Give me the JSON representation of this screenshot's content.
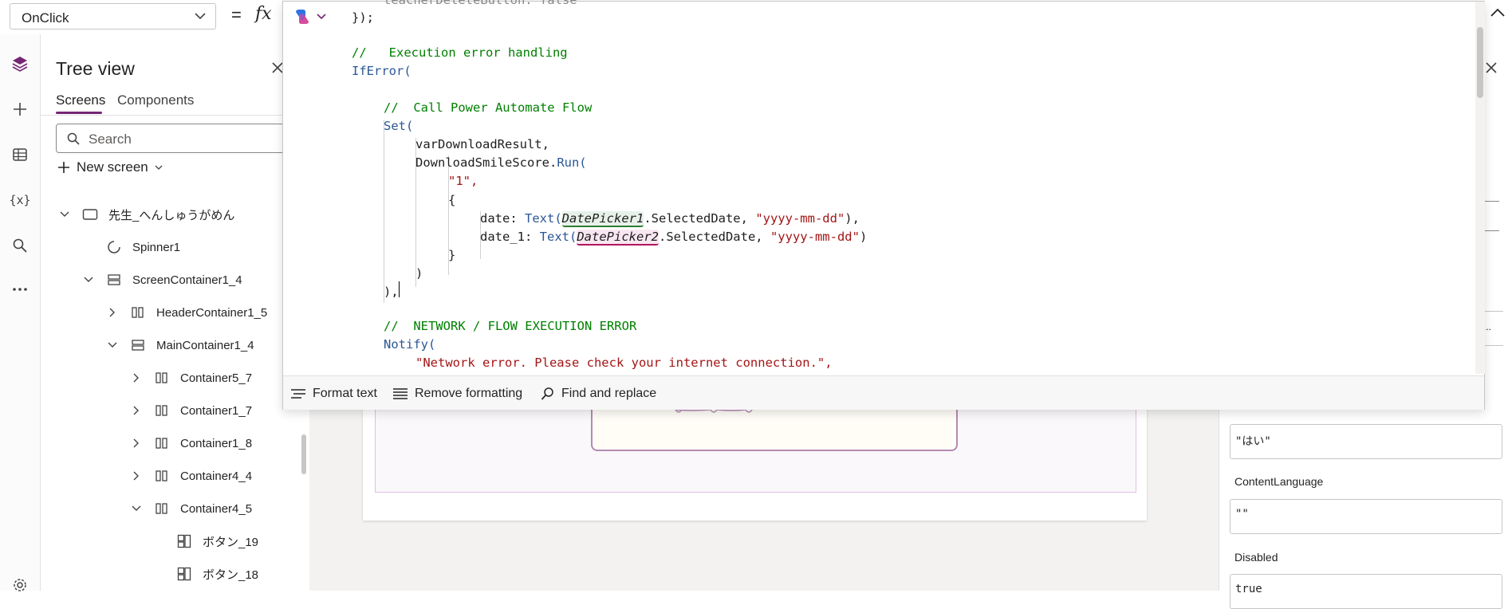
{
  "formula_bar": {
    "property": "OnClick",
    "equals": "=",
    "fx": "fx"
  },
  "tree_view": {
    "title": "Tree view",
    "tabs": {
      "screens": "Screens",
      "components": "Components"
    },
    "search_placeholder": "Search",
    "new_screen": "New screen",
    "items": [
      {
        "label": "先生_へんしゅうがめん",
        "icon": "screen-icon",
        "expanded": true
      },
      {
        "label": "Spinner1",
        "icon": "spinner-icon"
      },
      {
        "label": "ScreenContainer1_4",
        "icon": "vertical-container-icon",
        "expanded": true
      },
      {
        "label": "HeaderContainer1_5",
        "icon": "horizontal-container-icon",
        "expanded": false
      },
      {
        "label": "MainContainer1_4",
        "icon": "vertical-container-icon",
        "expanded": true
      },
      {
        "label": "Container5_7",
        "icon": "horizontal-container-icon",
        "expanded": false
      },
      {
        "label": "Container1_7",
        "icon": "horizontal-container-icon",
        "expanded": false
      },
      {
        "label": "Container1_8",
        "icon": "horizontal-container-icon",
        "expanded": false
      },
      {
        "label": "Container4_4",
        "icon": "horizontal-container-icon",
        "expanded": false
      },
      {
        "label": "Container4_5",
        "icon": "horizontal-container-icon",
        "expanded": true
      },
      {
        "label": "ボタン_19",
        "icon": "button-icon"
      },
      {
        "label": "ボタン_18",
        "icon": "button-icon"
      }
    ]
  },
  "editor": {
    "code_lines": {
      "l0": "teacherDeleteButton: false",
      "l1": "});",
      "l3": "//   Execution error handling",
      "l4": "IfError(",
      "l6": "//  Call Power Automate Flow",
      "l7": "Set(",
      "l8": "varDownloadResult,",
      "l9a": "DownloadSmileScore.",
      "l9b": "Run(",
      "l10": "\"1\",",
      "l11": "{",
      "l12a": "date: ",
      "l12b": "Text(",
      "l12c": "DatePicker1",
      "l12d": ".SelectedDate, ",
      "l12e": "\"yyyy-mm-dd\"",
      "l12f": "),",
      "l13a": "date_1: ",
      "l13b": "Text(",
      "l13c": "DatePicker2",
      "l13d": ".SelectedDate, ",
      "l13e": "\"yyyy-mm-dd\"",
      "l13f": ")",
      "l14": "}",
      "l15": ")",
      "l16": "),",
      "l18": "//  NETWORK / FLOW EXECUTION ERROR",
      "l19": "Notify(",
      "l20": "\"Network error. Please check your internet connection.\","
    },
    "footer": {
      "format_text": "Format text",
      "remove_formatting": "Remove formatting",
      "find_replace": "Find and replace"
    }
  },
  "properties": {
    "value_box_1": "\"はい\"",
    "content_language_label": "ContentLanguage",
    "content_language_value": "\"\"",
    "disabled_label": "Disabled",
    "disabled_value": "true",
    "ellipsis": "..."
  },
  "colors": {
    "accent": "#742774",
    "comment": "#008000",
    "function": "#2b5797",
    "string": "#a31515"
  }
}
